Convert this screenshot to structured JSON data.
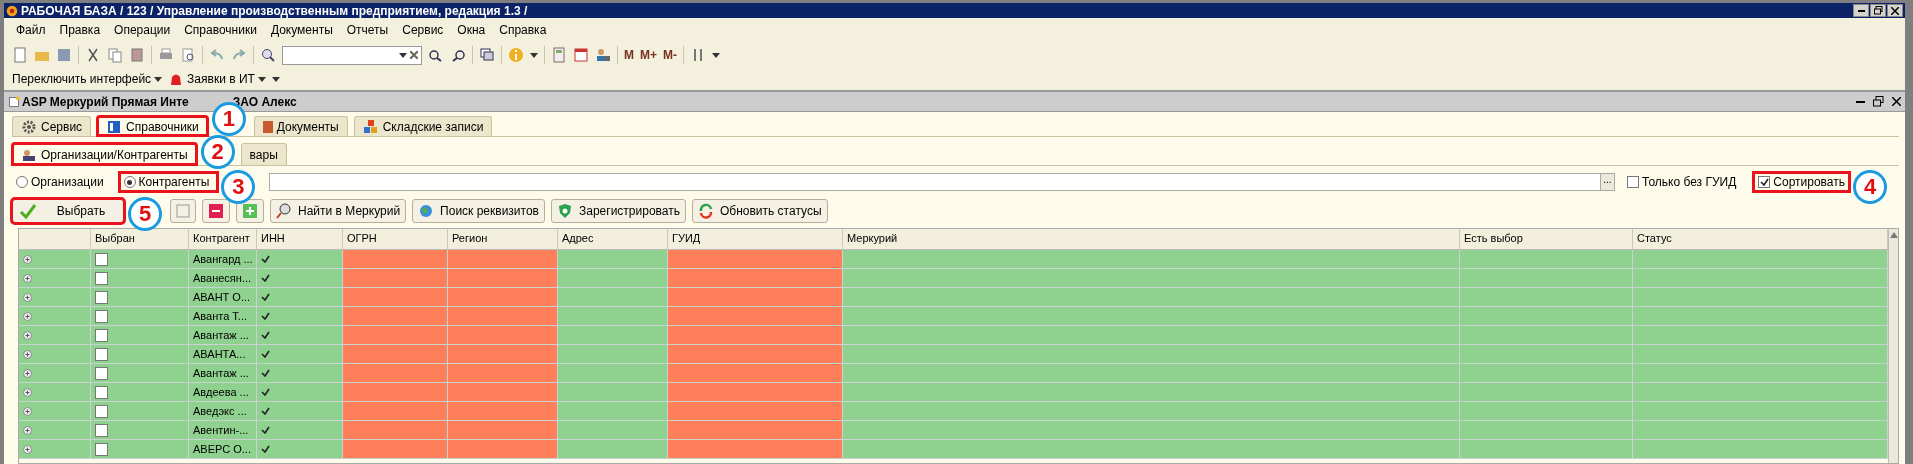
{
  "window": {
    "title": "РАБОЧАЯ БАЗА / 123 /  Управление производственным предприятием, редакция 1.3 /"
  },
  "menu": [
    "Файл",
    "Правка",
    "Операции",
    "Справочники",
    "Документы",
    "Отчеты",
    "Сервис",
    "Окна",
    "Справка"
  ],
  "toolbar": {
    "memory_keys": [
      "M",
      "M+",
      "M-"
    ]
  },
  "toolbar2": [
    {
      "label": "Переключить интерфейс",
      "kind": "plain"
    },
    {
      "label": "Заявки в ИТ",
      "kind": "alarm"
    }
  ],
  "form": {
    "title_parts": [
      "ASP Меркурий Прямая Инте",
      "ЗАО Алекс"
    ]
  },
  "tabs": [
    {
      "label": "Сервис",
      "selected": false,
      "marked": false,
      "kind": "gear"
    },
    {
      "label": "Справочники",
      "selected": true,
      "marked": true,
      "callout": "1",
      "kind": "book"
    },
    {
      "label": "Документы",
      "selected": false,
      "marked": false,
      "kind": "doc"
    },
    {
      "label": "Складские записи",
      "selected": false,
      "marked": false,
      "kind": "boxes"
    }
  ],
  "subtabs": [
    {
      "label": "Организации/Контрагенты",
      "selected": true,
      "marked": true,
      "callout": "2"
    },
    {
      "label": "вары",
      "selected": false,
      "marked": false
    }
  ],
  "radios": [
    {
      "label": "Организации",
      "selected": false,
      "marked": false
    },
    {
      "label": "Контрагенты",
      "selected": true,
      "marked": true,
      "callout": "3"
    }
  ],
  "filter": {
    "button": "..."
  },
  "checkboxes": [
    {
      "label": "Только без ГУИД",
      "checked": false,
      "marked": false
    },
    {
      "label": "Сортировать",
      "checked": true,
      "marked": true,
      "callout": "4"
    }
  ],
  "buttons": [
    {
      "kind": "select",
      "label": "Выбрать",
      "marked": true,
      "callout": "5"
    },
    {
      "kind": "blank"
    },
    {
      "kind": "remove"
    },
    {
      "kind": "add"
    },
    {
      "kind": "find",
      "label": "Найти в Меркурий"
    },
    {
      "kind": "globe",
      "label": "Поиск реквизитов"
    },
    {
      "kind": "shield",
      "label": "Зарегистрировать"
    },
    {
      "kind": "refresh",
      "label": "Обновить статусы"
    }
  ],
  "table": {
    "columns": [
      {
        "label": "Выбран",
        "color": "#8fd18f"
      },
      {
        "label": "Контрагент",
        "color": "#8fd18f"
      },
      {
        "label": "ИНН",
        "color": "#8fd18f"
      },
      {
        "label": "ОГРН",
        "color": "#ff7f5a"
      },
      {
        "label": "Регион",
        "color": "#ff7f5a"
      },
      {
        "label": "Адрес",
        "color": "#8fd18f"
      },
      {
        "label": "ГУИД",
        "color": "#ff7f5a"
      },
      {
        "label": "Меркурий",
        "color": "#8fd18f"
      },
      {
        "label": "Есть выбор",
        "color": "#8fd18f"
      },
      {
        "label": "Статус",
        "color": "#8fd18f"
      }
    ],
    "rows": [
      {
        "name": "Авангард ...",
        "selected": false,
        "inn": true
      },
      {
        "name": "Аванесян...",
        "selected": false,
        "inn": true
      },
      {
        "name": "АВАНТ О...",
        "selected": false,
        "inn": true
      },
      {
        "name": "Аванта Т...",
        "selected": false,
        "inn": true
      },
      {
        "name": "Авантаж ...",
        "selected": false,
        "inn": true
      },
      {
        "name": "АВАНТА...",
        "selected": false,
        "inn": true
      },
      {
        "name": "Авантаж ...",
        "selected": false,
        "inn": true
      },
      {
        "name": "Авдеева ...",
        "selected": false,
        "inn": true
      },
      {
        "name": "Аведэкс ...",
        "selected": false,
        "inn": true
      },
      {
        "name": "Авентин-...",
        "selected": false,
        "inn": true
      },
      {
        "name": "АВЕРС О...",
        "selected": false,
        "inn": true
      }
    ]
  }
}
